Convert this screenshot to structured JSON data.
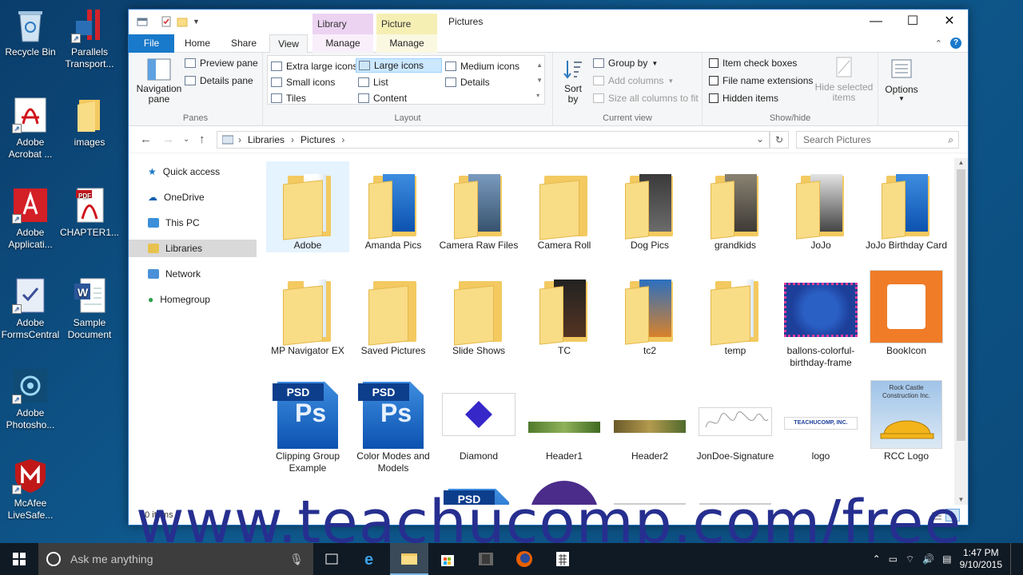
{
  "desktop": {
    "icons": [
      {
        "label": "Recycle Bin"
      },
      {
        "label": "Parallels Transport..."
      },
      {
        "label": "Adobe Acrobat ..."
      },
      {
        "label": "images"
      },
      {
        "label": "Adobe Applicati..."
      },
      {
        "label": "CHAPTER1..."
      },
      {
        "label": "Adobe FormsCentral"
      },
      {
        "label": "Sample Document"
      },
      {
        "label": "Adobe Photosho..."
      },
      {
        "label": "McAfee LiveSafe..."
      }
    ]
  },
  "window": {
    "title": "Pictures",
    "context_tabs": {
      "library_tools": "Library Tools",
      "picture_tools": "Picture Tools"
    },
    "tabs": {
      "file": "File",
      "home": "Home",
      "share": "Share",
      "view": "View",
      "manage1": "Manage",
      "manage2": "Manage"
    },
    "ribbon": {
      "panes": {
        "label": "Panes",
        "navigation_pane": "Navigation pane",
        "preview_pane": "Preview pane",
        "details_pane": "Details pane"
      },
      "layout": {
        "label": "Layout",
        "extra_large_icons": "Extra large icons",
        "large_icons": "Large icons",
        "medium_icons": "Medium icons",
        "small_icons": "Small icons",
        "list": "List",
        "details": "Details",
        "tiles": "Tiles",
        "content": "Content"
      },
      "current_view": {
        "label": "Current view",
        "sort_by": "Sort by",
        "group_by": "Group by",
        "add_columns": "Add columns",
        "size_all_columns": "Size all columns to fit"
      },
      "show_hide": {
        "label": "Show/hide",
        "item_check_boxes": "Item check boxes",
        "file_name_extensions": "File name extensions",
        "hidden_items": "Hidden items",
        "hide_selected_items": "Hide selected items"
      },
      "options": "Options"
    },
    "address": {
      "crumbs": [
        "Libraries",
        "Pictures"
      ],
      "search_placeholder": "Search Pictures"
    },
    "nav": {
      "items": [
        "Quick access",
        "OneDrive",
        "This PC",
        "Libraries",
        "Network",
        "Homegroup"
      ]
    },
    "items": [
      {
        "name": "Adobe",
        "kind": "folder"
      },
      {
        "name": "Amanda Pics",
        "kind": "folder-psd"
      },
      {
        "name": "Camera Raw Files",
        "kind": "folder-photo"
      },
      {
        "name": "Camera Roll",
        "kind": "folder"
      },
      {
        "name": "Dog Pics",
        "kind": "folder-photo"
      },
      {
        "name": "grandkids",
        "kind": "folder-photo"
      },
      {
        "name": "JoJo",
        "kind": "folder-photo"
      },
      {
        "name": "JoJo Birthday Card",
        "kind": "folder-psd"
      },
      {
        "name": "MP Navigator EX",
        "kind": "folder"
      },
      {
        "name": "Saved Pictures",
        "kind": "folder"
      },
      {
        "name": "Slide Shows",
        "kind": "folder"
      },
      {
        "name": "TC",
        "kind": "folder-photo"
      },
      {
        "name": "tc2",
        "kind": "folder-photo"
      },
      {
        "name": "temp",
        "kind": "folder"
      },
      {
        "name": "ballons-colorful-birthday-frame",
        "kind": "image"
      },
      {
        "name": "BookIcon",
        "kind": "image"
      },
      {
        "name": "Clipping Group Example",
        "kind": "psd"
      },
      {
        "name": "Color Modes and Models",
        "kind": "psd"
      },
      {
        "name": "Diamond",
        "kind": "image"
      },
      {
        "name": "Header1",
        "kind": "image"
      },
      {
        "name": "Header2",
        "kind": "image"
      },
      {
        "name": "JonDoe-Signature",
        "kind": "image"
      },
      {
        "name": "logo",
        "kind": "image"
      },
      {
        "name": "RCC Logo",
        "kind": "image"
      }
    ],
    "status": "30 items"
  },
  "watermark": "www.teachucomp.com/free",
  "taskbar": {
    "search_placeholder": "Ask me anything",
    "time": "1:47 PM",
    "date": "9/10/2015"
  },
  "logo_text": {
    "psd": "PSD",
    "ps": "Ps",
    "pdf": "PDF",
    "rcc": "Rock Castle Construction Inc.",
    "teachucomp": "TEACHUCOMP, INC."
  }
}
